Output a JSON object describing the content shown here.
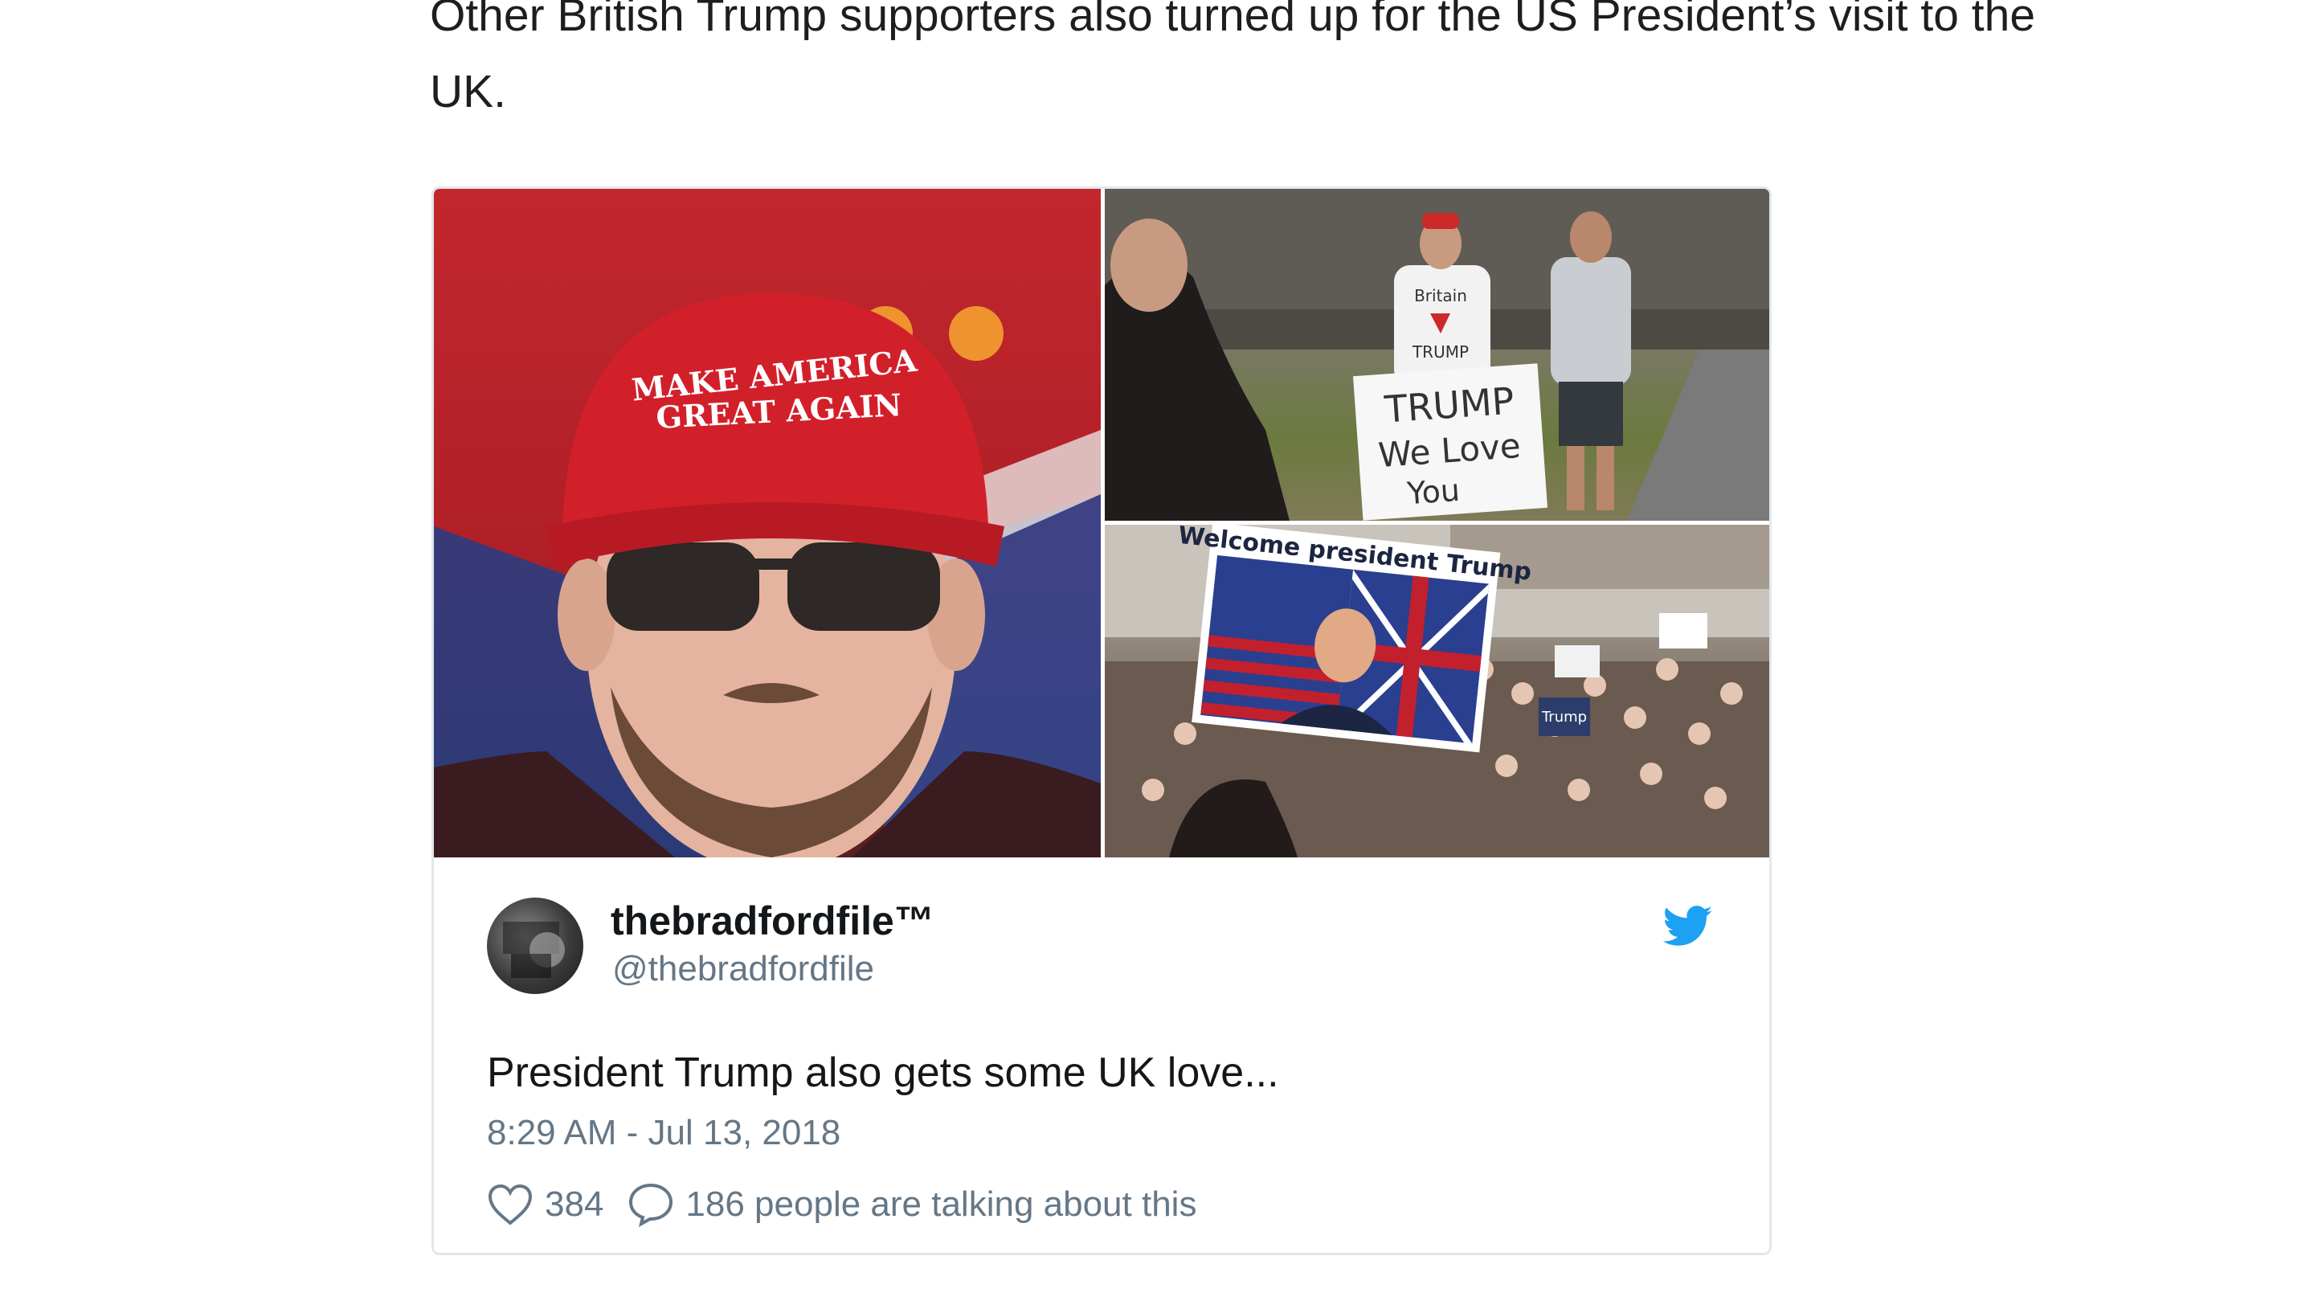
{
  "article": {
    "paragraph": "Other British Trump supporters also turned up for the US President’s visit to the UK."
  },
  "tweet": {
    "media": {
      "images": [
        {
          "alt": "Man wearing red hat and sunglasses",
          "hat_line1": "MAKE AMERICA",
          "hat_line2": "GREAT AGAIN"
        },
        {
          "alt": "Supporters holding sign",
          "shirt_line1": "Britain",
          "shirt_line2": "TRUMP",
          "sign_line1": "TRUMP",
          "sign_line2": "We Love",
          "sign_line3": "You"
        },
        {
          "alt": "Crowd with banner",
          "banner_text": "Welcome president Trump",
          "crowd_sign": "Trump"
        }
      ],
      "info_icon": "info-icon"
    },
    "user": {
      "display_name": "thebradfordfile™",
      "handle": "@thebradfordfile",
      "avatar_icon": "avatar"
    },
    "brand_icon": "twitter-bird-icon",
    "text": "President Trump also gets some UK love...",
    "timestamp": "8:29 AM - Jul 13, 2018",
    "likes": "384",
    "talking": "186 people are talking about this",
    "colors": {
      "twitter_blue": "#1da1f2",
      "meta_gray": "#657786",
      "border": "#e1e8ed"
    }
  }
}
